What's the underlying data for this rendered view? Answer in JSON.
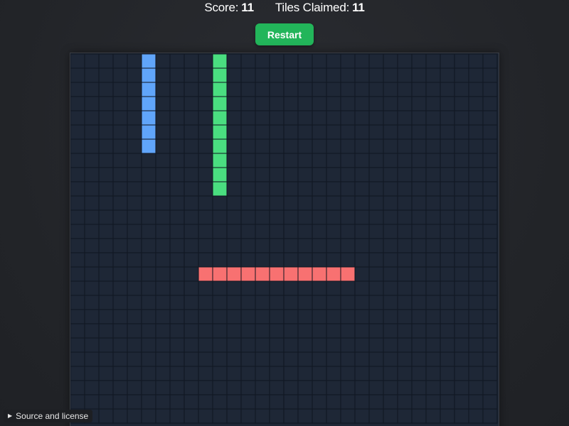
{
  "hud": {
    "score_label": "Score:",
    "score_value": "11",
    "tiles_label": "Tiles Claimed:",
    "tiles_value": "11"
  },
  "controls": {
    "restart_label": "Restart"
  },
  "board": {
    "columns": 30,
    "rows": 26,
    "empty_color": "#1e2736",
    "grid_line_color": "#0f1520",
    "players": [
      {
        "color": "#60a5fa",
        "cells": [
          [
            5,
            0
          ],
          [
            5,
            1
          ],
          [
            5,
            2
          ],
          [
            5,
            3
          ],
          [
            5,
            4
          ],
          [
            5,
            5
          ],
          [
            5,
            6
          ]
        ]
      },
      {
        "color": "#4ade80",
        "cells": [
          [
            10,
            0
          ],
          [
            10,
            1
          ],
          [
            10,
            2
          ],
          [
            10,
            3
          ],
          [
            10,
            4
          ],
          [
            10,
            5
          ],
          [
            10,
            6
          ],
          [
            10,
            7
          ],
          [
            10,
            8
          ],
          [
            10,
            9
          ]
        ]
      },
      {
        "color": "#f87171",
        "cells": [
          [
            9,
            15
          ],
          [
            10,
            15
          ],
          [
            11,
            15
          ],
          [
            12,
            15
          ],
          [
            13,
            15
          ],
          [
            14,
            15
          ],
          [
            15,
            15
          ],
          [
            16,
            15
          ],
          [
            17,
            15
          ],
          [
            18,
            15
          ],
          [
            19,
            15
          ]
        ]
      }
    ]
  },
  "footer": {
    "toggle_icon": "triangle-right-icon",
    "source_label": "Source and license"
  }
}
